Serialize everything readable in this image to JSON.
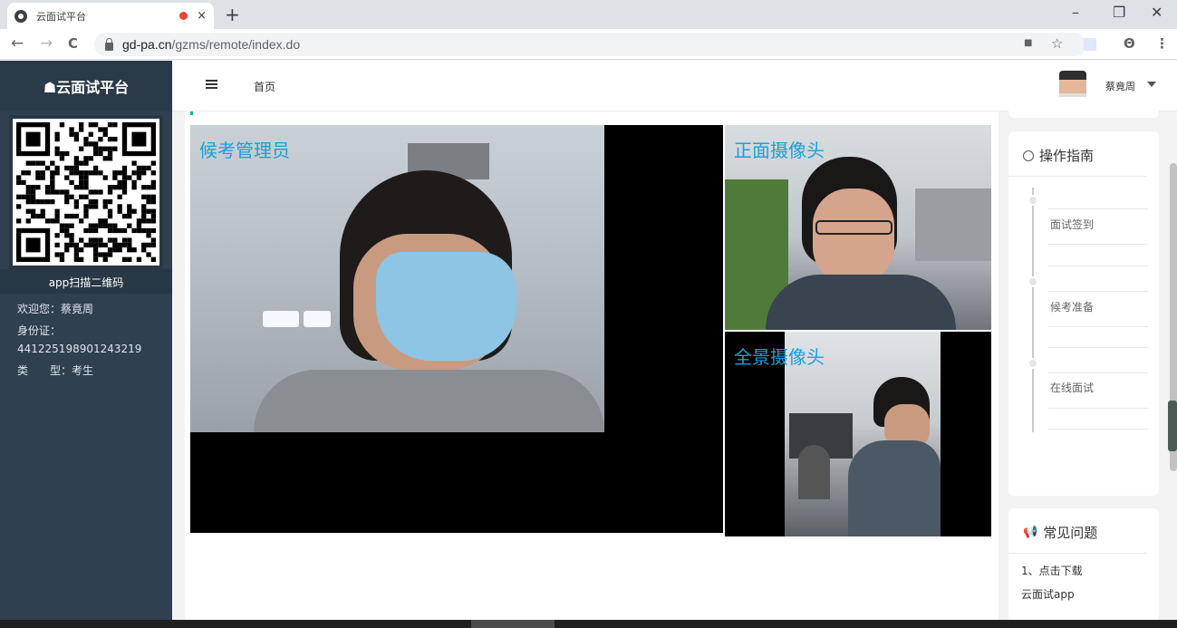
{
  "browser": {
    "tab_title": "云面试平台",
    "tab_close": "×",
    "new_tab": "+",
    "url_host": "gd-pa.cn",
    "url_path": "/gzms/remote/index.do",
    "back": "←",
    "forward": "→",
    "reload": "C",
    "minimize": "–",
    "restore": "❐",
    "close": "✕",
    "bookmark_star": "☆",
    "camera_icon": "■",
    "menu_dots": "⋮",
    "profile": "Θ"
  },
  "sidebar": {
    "brand": "☗云面试平台",
    "qr_label": "app扫描二维码",
    "welcome": "欢迎您：蔡竟周",
    "id_label": "身份证：",
    "id_number": "441225198901243219",
    "type_label": "类　　型：考生"
  },
  "topbar": {
    "home": "首页",
    "username": "蔡竟周"
  },
  "videos": {
    "admin_label": "候考管理员",
    "front_label": "正面摄像头",
    "pano_label": "全景摄像头"
  },
  "guide": {
    "title": "操作指南",
    "steps": [
      "面试签到",
      "候考准备",
      "在线面试"
    ]
  },
  "faq": {
    "title": "常见问题",
    "item1_a": "1、点击下载",
    "item1_b": "云面试app"
  },
  "colors": {
    "sidebar": "#2f4050",
    "accent": "#1ab394",
    "video_label": "#1aa0d9"
  }
}
